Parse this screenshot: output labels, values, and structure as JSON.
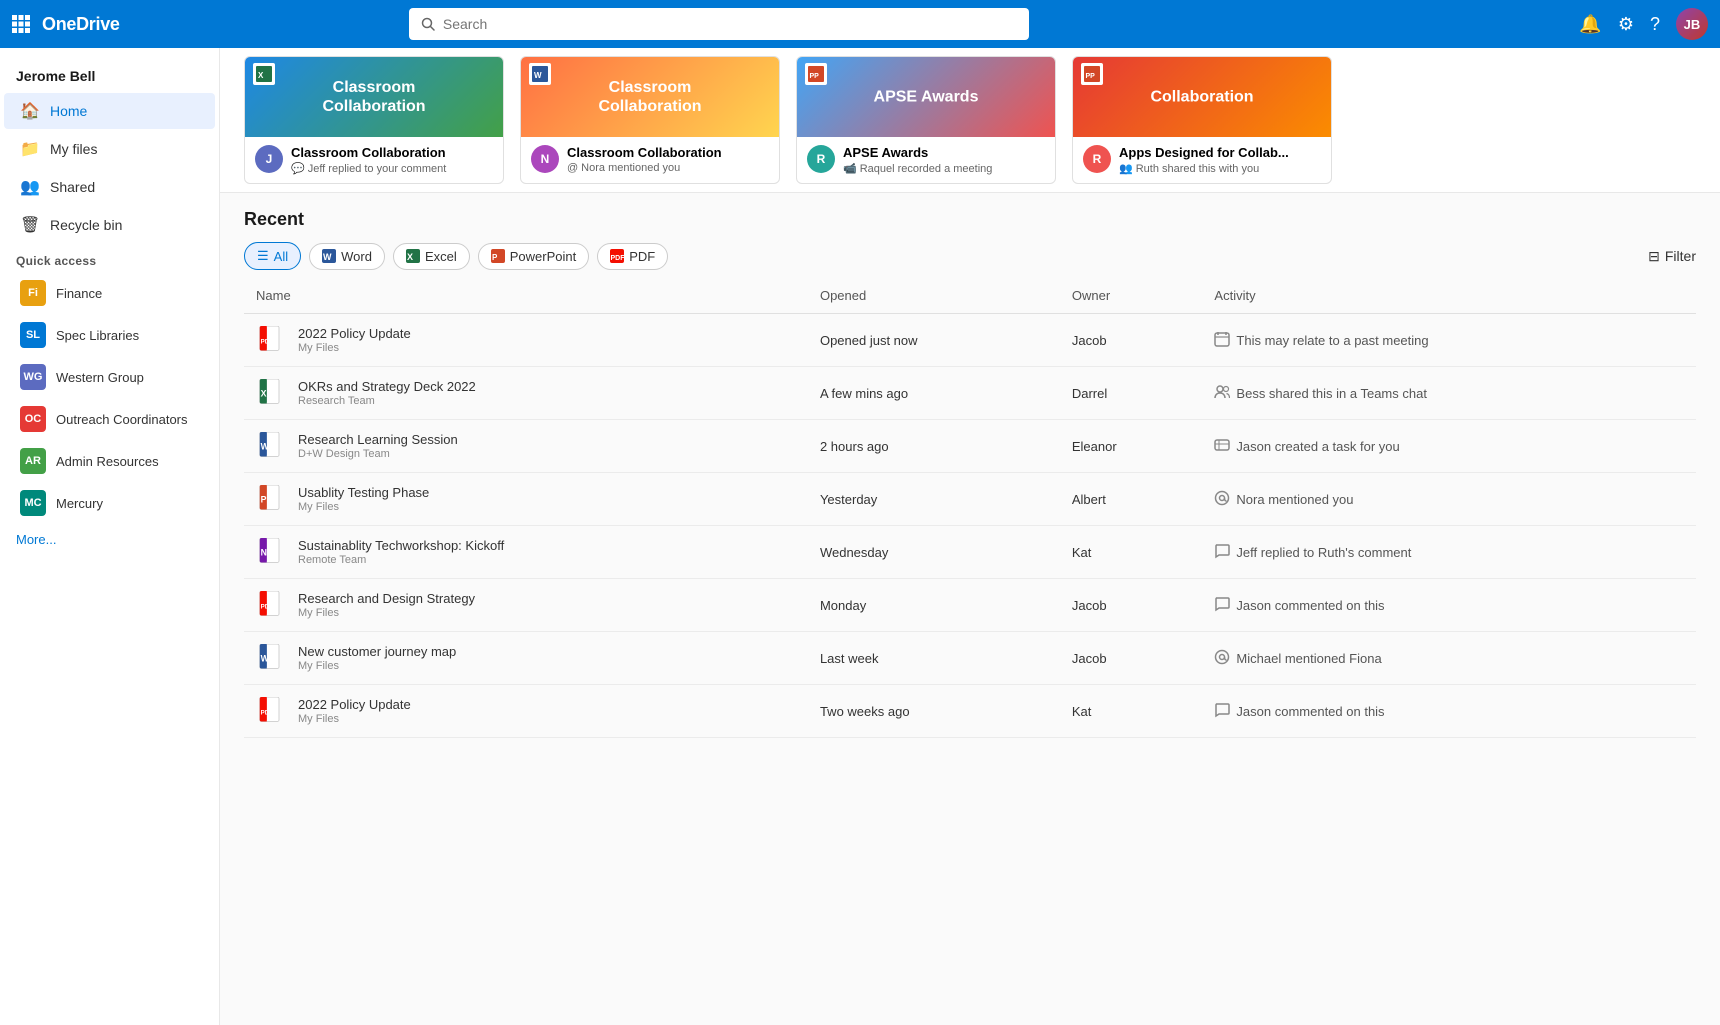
{
  "topbar": {
    "app_name": "OneDrive",
    "search_placeholder": "Search",
    "waffle_icon": "⊞",
    "bell_icon": "🔔",
    "settings_icon": "⚙",
    "help_icon": "?"
  },
  "sidebar": {
    "user_name": "Jerome Bell",
    "nav": [
      {
        "id": "home",
        "label": "Home",
        "icon": "🏠"
      },
      {
        "id": "my-files",
        "label": "My files",
        "icon": "📁"
      },
      {
        "id": "shared",
        "label": "Shared",
        "icon": "👥"
      },
      {
        "id": "recycle-bin",
        "label": "Recycle bin",
        "icon": "🗑"
      }
    ],
    "quick_access_label": "Quick access",
    "quick_items": [
      {
        "id": "finance",
        "label": "Finance",
        "abbr": "Fi",
        "color": "#e8a010"
      },
      {
        "id": "spec-libraries",
        "label": "Spec Libraries",
        "abbr": "SL",
        "color": "#0078d4"
      },
      {
        "id": "western-group",
        "label": "Western Group",
        "abbr": "WG",
        "color": "#5c6bc0"
      },
      {
        "id": "outreach-coordinators",
        "label": "Outreach Coordinators",
        "abbr": "OC",
        "color": "#e53935"
      },
      {
        "id": "admin-resources",
        "label": "Admin Resources",
        "abbr": "AR",
        "color": "#43a047"
      },
      {
        "id": "mercury",
        "label": "Mercury",
        "abbr": "MC",
        "color": "#00897b"
      }
    ],
    "more_label": "More..."
  },
  "activity_cards": [
    {
      "id": "card1",
      "title": "Classroom Collaboration",
      "avatar_text": "J",
      "avatar_color": "#5c6bc0",
      "activity_icon": "💬",
      "activity_text": "Jeff replied to your comment",
      "thumb_class": "card-thumb-1",
      "thumb_text": "Classroom\nCollaboration",
      "file_icon_color": "#217346"
    },
    {
      "id": "card2",
      "title": "Classroom Collaboration",
      "avatar_text": "N",
      "avatar_color": "#ab47bc",
      "activity_icon": "@",
      "activity_text": "Nora mentioned you",
      "thumb_class": "card-thumb-2",
      "thumb_text": "Classroom\nCollaboration",
      "file_icon_color": "#2b579a"
    },
    {
      "id": "card3",
      "title": "APSE Awards",
      "avatar_text": "R",
      "avatar_color": "#26a69a",
      "activity_icon": "📹",
      "activity_text": "Raquel recorded a meeting",
      "thumb_class": "card-thumb-3",
      "thumb_text": "APSE Awards",
      "file_icon_color": "#d24726"
    },
    {
      "id": "card4",
      "title": "Apps Designed for Collab...",
      "avatar_text": "R",
      "avatar_color": "#ef5350",
      "activity_icon": "👥",
      "activity_text": "Ruth shared this with you",
      "thumb_class": "card-thumb-4",
      "thumb_text": "Collaboration",
      "file_icon_color": "#d24726"
    }
  ],
  "recent": {
    "title": "Recent",
    "filter_buttons": [
      {
        "id": "all",
        "label": "All",
        "active": true
      },
      {
        "id": "word",
        "label": "Word",
        "active": false
      },
      {
        "id": "excel",
        "label": "Excel",
        "active": false
      },
      {
        "id": "powerpoint",
        "label": "PowerPoint",
        "active": false
      },
      {
        "id": "pdf",
        "label": "PDF",
        "active": false
      }
    ],
    "filter_label": "Filter",
    "columns": {
      "name": "Name",
      "opened": "Opened",
      "owner": "Owner",
      "activity": "Activity"
    },
    "files": [
      {
        "id": "f1",
        "name": "2022 Policy Update",
        "location": "My Files",
        "opened": "Opened just now",
        "owner": "Jacob",
        "activity_icon": "📅",
        "activity": "This may relate to a past meeting",
        "type": "pdf"
      },
      {
        "id": "f2",
        "name": "OKRs and Strategy Deck 2022",
        "location": "Research Team",
        "opened": "A few mins ago",
        "owner": "Darrel",
        "activity_icon": "👥",
        "activity": "Bess shared this in a Teams chat",
        "type": "excel"
      },
      {
        "id": "f3",
        "name": "Research Learning Session",
        "location": "D+W Design Team",
        "opened": "2 hours ago",
        "owner": "Eleanor",
        "activity_icon": "☑",
        "activity": "Jason created a task for you",
        "type": "word"
      },
      {
        "id": "f4",
        "name": "Usablity Testing Phase",
        "location": "My Files",
        "opened": "Yesterday",
        "owner": "Albert",
        "activity_icon": "@",
        "activity": "Nora mentioned you",
        "type": "ppt"
      },
      {
        "id": "f5",
        "name": "Sustainablity Techworkshop: Kickoff",
        "location": "Remote Team",
        "opened": "Wednesday",
        "owner": "Kat",
        "activity_icon": "💬",
        "activity": "Jeff replied to Ruth's comment",
        "type": "onenote"
      },
      {
        "id": "f6",
        "name": "Research and Design Strategy",
        "location": "My Files",
        "opened": "Monday",
        "owner": "Jacob",
        "activity_icon": "💬",
        "activity": "Jason commented on this",
        "type": "pdf"
      },
      {
        "id": "f7",
        "name": "New customer journey map",
        "location": "My Files",
        "opened": "Last week",
        "owner": "Jacob",
        "activity_icon": "@",
        "activity": "Michael mentioned Fiona",
        "type": "word"
      },
      {
        "id": "f8",
        "name": "2022 Policy Update",
        "location": "My Files",
        "opened": "Two weeks ago",
        "owner": "Kat",
        "activity_icon": "💬",
        "activity": "Jason commented on this",
        "type": "pdf"
      }
    ]
  }
}
